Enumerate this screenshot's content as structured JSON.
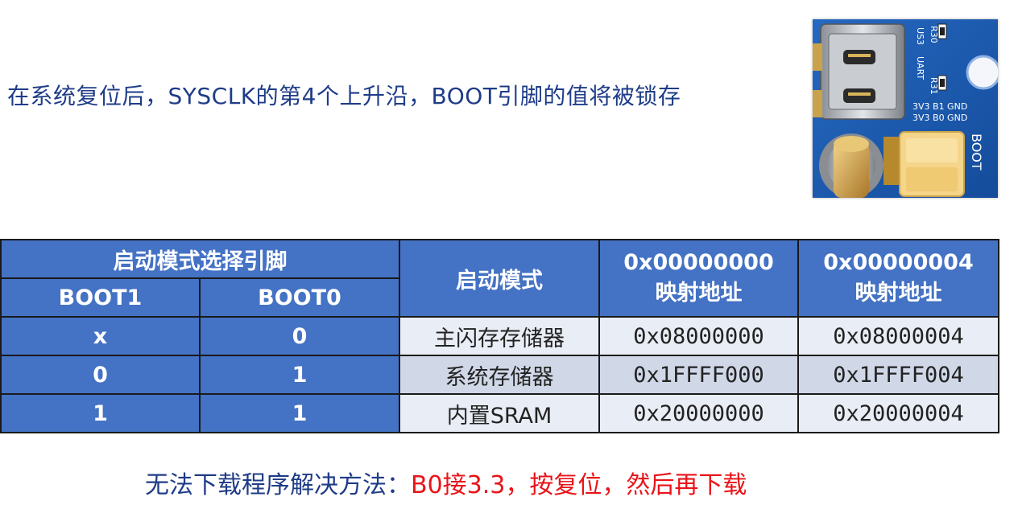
{
  "intro": "在系统复位后，SYSCLK的第4个上升沿，BOOT引脚的值将被锁存",
  "board": {
    "silkscreen": {
      "r30": "R30",
      "us3": "US3",
      "uart": "UART",
      "r31": "R31",
      "row1": "3V3 B1 GND",
      "row2": "3V3 B0 GND",
      "boot": "BOOT"
    }
  },
  "table": {
    "group_header": "启动模式选择引脚",
    "boot1_header": "BOOT1",
    "boot0_header": "BOOT0",
    "mode_header": "启动模式",
    "addr0_header_line1": "0x00000000",
    "addr0_header_line2": "映射地址",
    "addr4_header_line1": "0x00000004",
    "addr4_header_line2": "映射地址",
    "rows": [
      {
        "boot1": "x",
        "boot0": "0",
        "mode": "主闪存存储器",
        "addr0": "0x08000000",
        "addr4": "0x08000004"
      },
      {
        "boot1": "0",
        "boot0": "1",
        "mode": "系统存储器",
        "addr0": "0x1FFFF000",
        "addr4": "0x1FFFF004"
      },
      {
        "boot1": "1",
        "boot0": "1",
        "mode": "内置SRAM",
        "addr0": "0x20000000",
        "addr4": "0x20000004"
      }
    ]
  },
  "footer": {
    "lead": "无法下载程序解决方法：",
    "fix": "B0接3.3，按复位，然后再下载"
  },
  "colors": {
    "header_blue": "#4472c4",
    "row_light_a": "#e9edf5",
    "row_light_b": "#d0d8e8",
    "text_navy": "#1f3c88",
    "text_red": "#e8141a",
    "pcb_blue": "#1d5fb5"
  }
}
